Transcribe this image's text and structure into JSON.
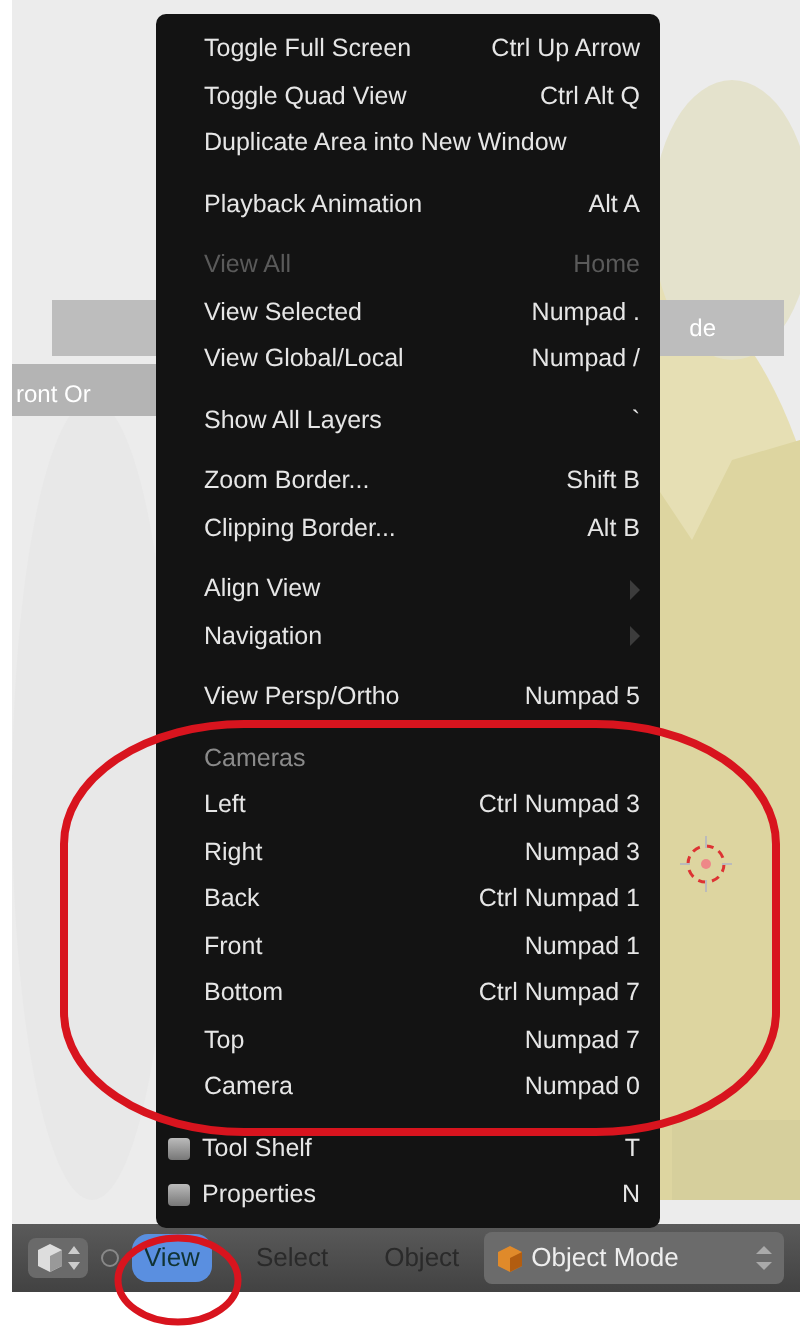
{
  "viewport": {
    "view_label": "ront Or",
    "header_fragment": "de"
  },
  "menu": {
    "items": [
      {
        "kind": "item",
        "label": "Toggle Full Screen",
        "shortcut": "Ctrl Up Arrow",
        "gap_before": false
      },
      {
        "kind": "item",
        "label": "Toggle Quad View",
        "shortcut": "Ctrl Alt Q",
        "gap_before": false
      },
      {
        "kind": "item",
        "label": "Duplicate Area into New Window",
        "gap_before": false
      },
      {
        "kind": "item",
        "label": "Playback Animation",
        "shortcut": "Alt A",
        "gap_before": true
      },
      {
        "kind": "item",
        "label": "View All",
        "shortcut": "Home",
        "disabled": true,
        "gap_before": true
      },
      {
        "kind": "item",
        "label": "View Selected",
        "shortcut": "Numpad .",
        "gap_before": false
      },
      {
        "kind": "item",
        "label": "View Global/Local",
        "shortcut": "Numpad /",
        "gap_before": false
      },
      {
        "kind": "item",
        "label": "Show All Layers",
        "shortcut": "`",
        "gap_before": true
      },
      {
        "kind": "item",
        "label": "Zoom Border...",
        "shortcut": "Shift B",
        "gap_before": true
      },
      {
        "kind": "item",
        "label": "Clipping Border...",
        "shortcut": "Alt B",
        "gap_before": false
      },
      {
        "kind": "submenu",
        "label": "Align View",
        "gap_before": true
      },
      {
        "kind": "submenu",
        "label": "Navigation",
        "gap_before": false
      },
      {
        "kind": "item",
        "label": "View Persp/Ortho",
        "shortcut": "Numpad 5",
        "gap_before": true
      },
      {
        "kind": "header",
        "label": "Cameras",
        "gap_before": true
      },
      {
        "kind": "item",
        "label": "Left",
        "shortcut": "Ctrl Numpad 3",
        "gap_before": false
      },
      {
        "kind": "item",
        "label": "Right",
        "shortcut": "Numpad 3",
        "gap_before": false
      },
      {
        "kind": "item",
        "label": "Back",
        "shortcut": "Ctrl Numpad 1",
        "gap_before": false
      },
      {
        "kind": "item",
        "label": "Front",
        "shortcut": "Numpad 1",
        "gap_before": false
      },
      {
        "kind": "item",
        "label": "Bottom",
        "shortcut": "Ctrl Numpad 7",
        "gap_before": false
      },
      {
        "kind": "item",
        "label": "Top",
        "shortcut": "Numpad 7",
        "gap_before": false
      },
      {
        "kind": "item",
        "label": "Camera",
        "shortcut": "Numpad 0",
        "gap_before": false
      },
      {
        "kind": "checkbox",
        "label": "Tool Shelf",
        "shortcut": "T",
        "checked": false,
        "gap_before": true
      },
      {
        "kind": "checkbox",
        "label": "Properties",
        "shortcut": "N",
        "checked": false,
        "gap_before": false
      }
    ]
  },
  "header_bar": {
    "menus": [
      {
        "label": "View",
        "selected": true
      },
      {
        "label": "Select",
        "selected": false
      },
      {
        "label": "Object",
        "selected": false
      }
    ],
    "mode": {
      "label": "Object Mode"
    }
  }
}
